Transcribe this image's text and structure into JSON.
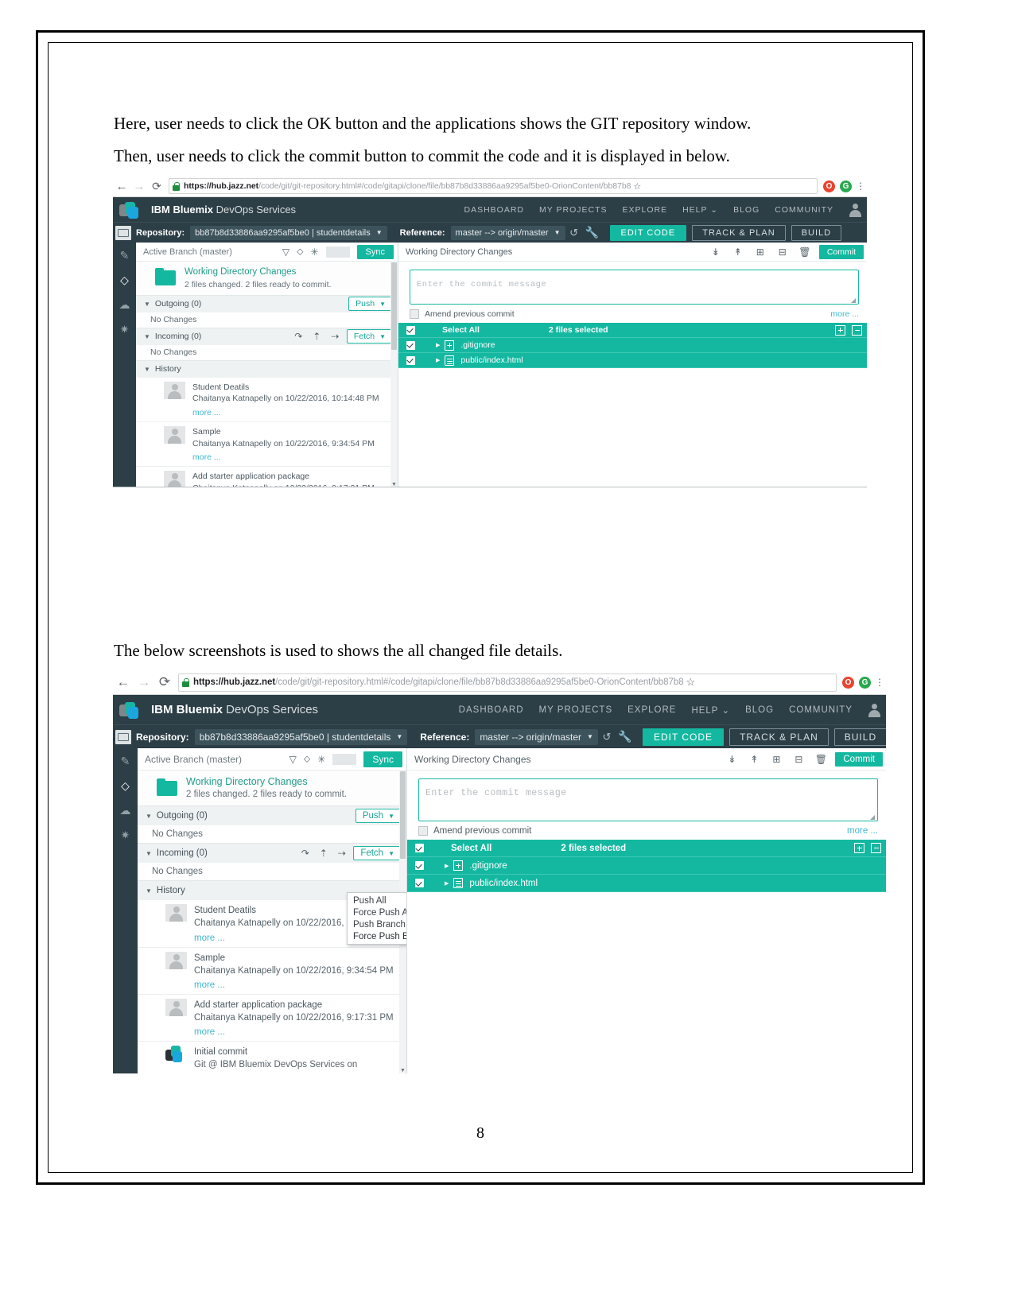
{
  "document": {
    "paragraph_1": "Here, user needs to click the OK button and the applications shows the GIT repository window.",
    "paragraph_2": "Then, user needs to click the commit button to commit the code and it is displayed in below.",
    "paragraph_3": "The below screenshots is used to shows the all changed file details.",
    "page_number": "8"
  },
  "browser": {
    "back_icon": "←",
    "forward_icon": "→",
    "reload_icon": "⟳",
    "lock_icon": "lock-icon",
    "url_host": "https://hub.jazz.net",
    "url_path": "/code/git/git-repository.html#/code/gitapi/clone/file/bb87b8d33886aa9295af5be0-OrionContent/bb87b8",
    "star_icon": "☆",
    "extension_opera": "O",
    "extension_green": "G",
    "menu_icon": "⋮"
  },
  "ibm_nav": {
    "brand_bold": "IBM Bluemix",
    "brand_rest": " DevOps Services",
    "links": [
      "DASHBOARD",
      "MY PROJECTS",
      "EXPLORE",
      "HELP ⌄",
      "BLOG",
      "COMMUNITY"
    ],
    "avatar": "user-avatar"
  },
  "repo_bar": {
    "repository_label": "Repository:",
    "repository_value": "bb87b8d33886aa9295af5be0 | studentdetails",
    "reference_label": "Reference:",
    "reference_value": "master --> origin/master",
    "caret": "▼",
    "history_icon": "↺",
    "wrench_icon": "🔧",
    "edit_code": "EDIT CODE",
    "track_plan": "TRACK & PLAN",
    "build_deploy": "BUILD"
  },
  "rail": {
    "icons": [
      "pencil-icon",
      "git-icon",
      "cloud-icon",
      "settings-icon"
    ]
  },
  "left_panel": {
    "branch_label": "Active Branch (master)",
    "filter_icon": "▽",
    "compare_icon": "⬦",
    "star_icon": "✳",
    "sync_button": "Sync",
    "working_dir_title": "Working Directory Changes",
    "working_dir_sub": "2 files changed. 2 files ready to commit.",
    "outgoing_title": "Outgoing (0)",
    "outgoing_empty": "No Changes",
    "push_button": "Push",
    "incoming_title": "Incoming (0)",
    "incoming_empty": "No Changes",
    "fetch_button": "Fetch",
    "incoming_icons": [
      "rebase-icon",
      "pull-icon",
      "merge-icon"
    ],
    "history_title": "History",
    "commits": [
      {
        "title": "Student Deatils",
        "meta": "Chaitanya Katnapelly on 10/22/2016, 10:14:48 PM",
        "more": "more ..."
      },
      {
        "title": "Sample",
        "meta": "Chaitanya Katnapelly on 10/22/2016, 9:34:54 PM",
        "more": "more ..."
      },
      {
        "title": "Add starter application package",
        "meta": "Chaitanya Katnapelly on 10/22/2016, 9:17:31 PM",
        "more": "more ..."
      },
      {
        "title": "Initial commit",
        "meta": "Git @ IBM Bluemix DevOps Services on",
        "more": ""
      }
    ]
  },
  "right_panel": {
    "header_title": "Working Directory Changes",
    "toolbar_icons": [
      "stage-all-icon",
      "unstage-all-icon",
      "checkout-icon",
      "discard-icon",
      "trash-icon"
    ],
    "commit_button": "Commit",
    "commit_message_placeholder": "Enter the commit message",
    "amend_label": "Amend previous commit",
    "more_link": "more ...",
    "select_all_label": "Select All",
    "files_selected": "2 files selected",
    "files": [
      {
        "name": ".gitignore",
        "icon": "file-added-icon"
      },
      {
        "name": "public/index.html",
        "icon": "file-modified-icon"
      }
    ]
  },
  "push_menu": {
    "items": [
      "Push All",
      "Force Push All",
      "Push Branch",
      "Force Push Branch"
    ],
    "selected": "Force Push Branch"
  },
  "colors": {
    "teal": "#14b8a0",
    "dark_nav": "#2c3e46",
    "link_blue": "#3fb8cf",
    "lock_green": "#1e8e3e"
  }
}
